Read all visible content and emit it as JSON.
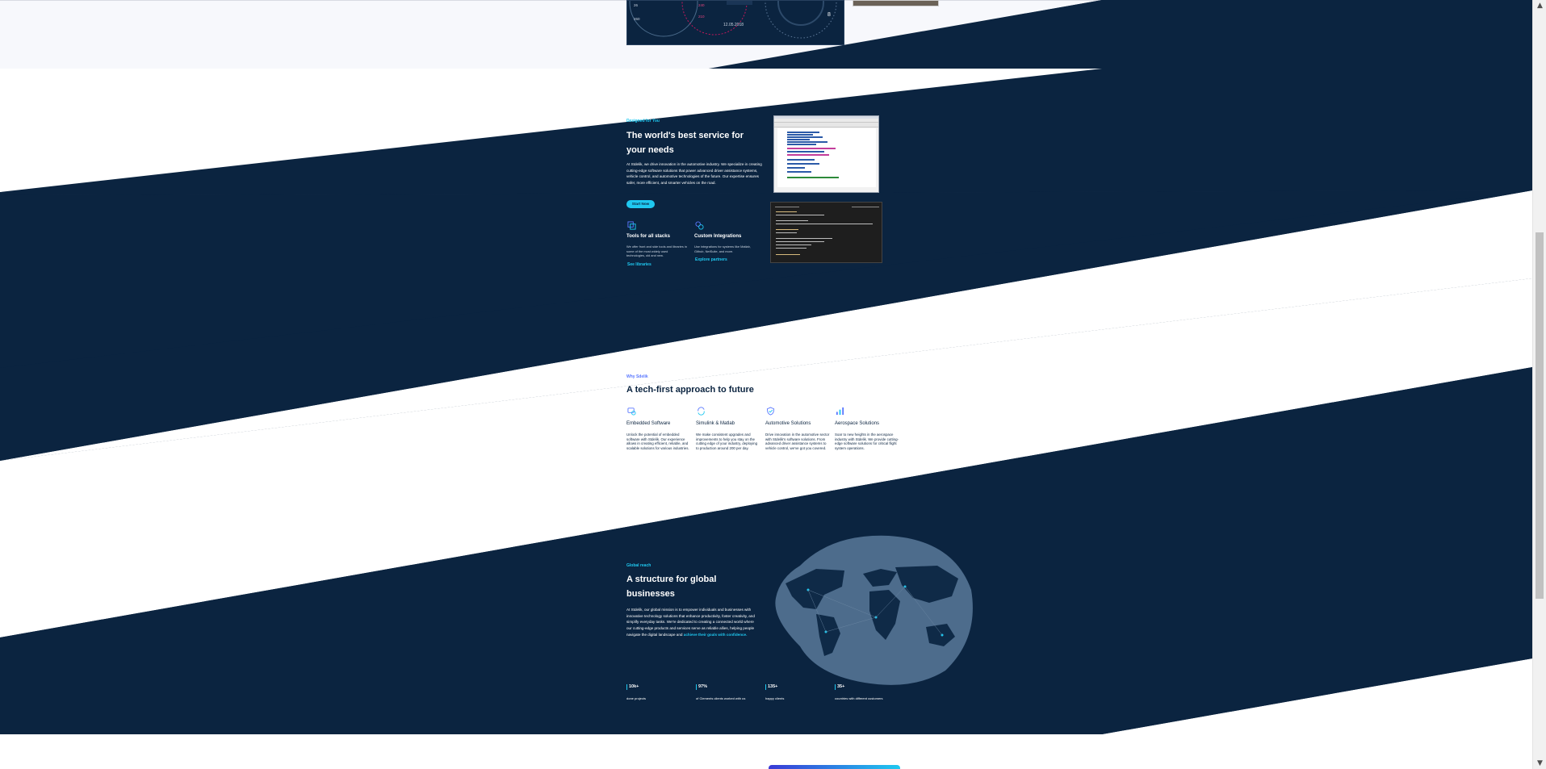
{
  "theme": {
    "navy": "#0b2440",
    "cyan": "#1fc8f0",
    "white": "#ffffff",
    "light_bg": "#f7f8fc",
    "accent_blue": "#5a78ff"
  },
  "hero_tail": {
    "dashboard_date": "12.05.2018",
    "gauge_left_numbers": [
      "26",
      "210",
      "240",
      "260"
    ],
    "gauge_right_numbers": [
      "8"
    ]
  },
  "service_section": {
    "eyebrow": "Designed for You",
    "title_line1": "The world's best service for",
    "title_line2": "your needs",
    "paragraph": "At Stdelik, we drive innovation in the automotive industry. We specialize in creating cutting-edge software solutions that power advanced driver assistance systems, vehicle control, and automotive technologies of the future. Our expertise ensures safer, more efficient, and smarter vehicles on the road.",
    "cta_label": "Start Now",
    "features": [
      {
        "icon": "stack-icon",
        "title": "Tools for all stacks",
        "text": "We offer front and side tools and libraries in some of the most widely used technologies, old and new.",
        "link": "See libraries"
      },
      {
        "icon": "integration-icon",
        "title": "Custom Integrations",
        "text": "Use integrations for systems like Matlab, Github, NetSuite, and more.",
        "link": "Explore partners"
      }
    ]
  },
  "tech_section": {
    "eyebrow": "Why Sdelik",
    "title": "A tech-first approach to future",
    "items": [
      {
        "icon": "embedded-icon",
        "title": "Embedded Software",
        "text": "Unlock the potential of embedded software with Stdelik. Our experience allows in creating efficient, reliable, and scalable solutions for various industries."
      },
      {
        "icon": "sync-icon",
        "title": "Simulink & Matlab",
        "text": "We make consistent upgrades and improvements to help you stay on the cutting edge of your industry, deploying to production around 200 per day."
      },
      {
        "icon": "shield-check-icon",
        "title": "Automotive Solutions",
        "text": "Drive innovation in the automotive sector with Stdelik's software solutions. From advanced driver assistance systems to vehicle control, we've got you covered."
      },
      {
        "icon": "bar-chart-icon",
        "title": "Aerospace Solutions",
        "text": "Soar to new heights in the aerospace industry with Stdelik. We provide cutting-edge software solutions for critical flight system operations."
      }
    ]
  },
  "global_section": {
    "eyebrow": "Global reach",
    "title_line1": "A structure for global",
    "title_line2": "businesses",
    "paragraph": "At Stdelik, our global mission is to empower individuals and businesses with innovative technology solutions that enhance productivity, foster creativity, and simplify everyday tasks. We're dedicated to creating a connected world where our cutting-edge products and services serve as reliable allies, helping people navigate the digital landscape and",
    "highlight": "achieve their goals with confidence.",
    "stats": [
      {
        "value": "10k+",
        "label": "done projects"
      },
      {
        "value": "97%",
        "label": "of Clements clients worked with us"
      },
      {
        "value": "135+",
        "label": "happy clients"
      },
      {
        "value": "35+",
        "label": "countries with different customers"
      }
    ]
  }
}
